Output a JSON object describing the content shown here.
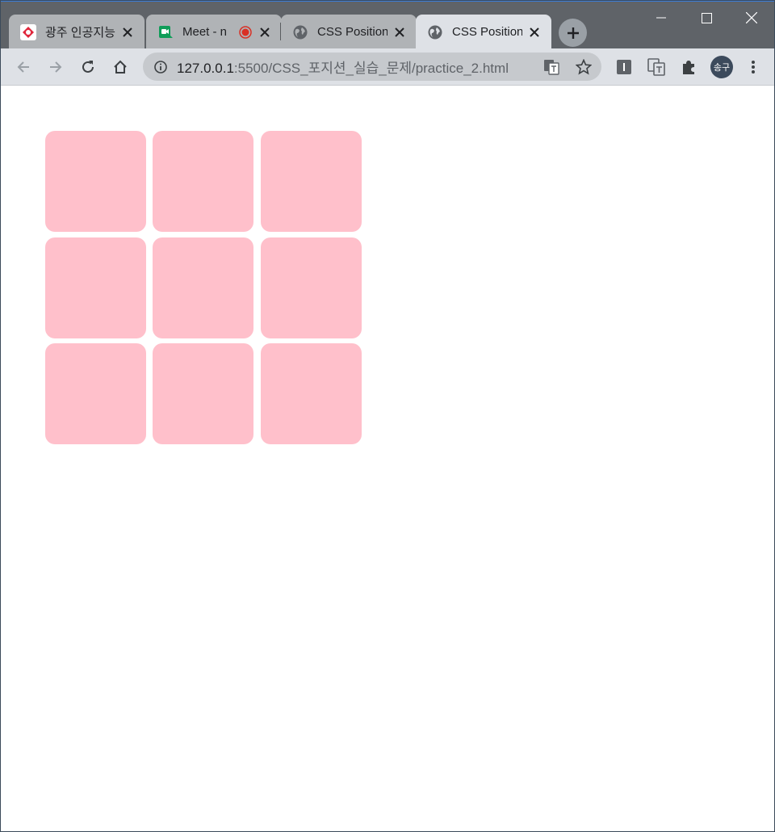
{
  "browser": {
    "tabs": [
      {
        "title": "광주 인공지능",
        "state": "inactive",
        "favicon": "ai-academy-favicon"
      },
      {
        "title": "Meet - n",
        "state": "inactive",
        "favicon": "meet-favicon",
        "recording": true
      },
      {
        "title": "CSS Position",
        "state": "inactive",
        "favicon": "globe-icon"
      },
      {
        "title": "CSS Position",
        "state": "active",
        "favicon": "globe-icon"
      }
    ],
    "address": {
      "host": "127.0.0.1",
      "rest": ":5500/CSS_포지션_실습_문제/practice_2.html"
    },
    "profile_initials": "송구"
  },
  "page": {
    "grid": {
      "rows": 3,
      "cols": 3,
      "box_color": "#ffc0cb"
    }
  },
  "colors": {
    "tabstrip": "#5f6368",
    "toolbar": "#dee1e6",
    "omnibox": "#c6c9cd"
  }
}
